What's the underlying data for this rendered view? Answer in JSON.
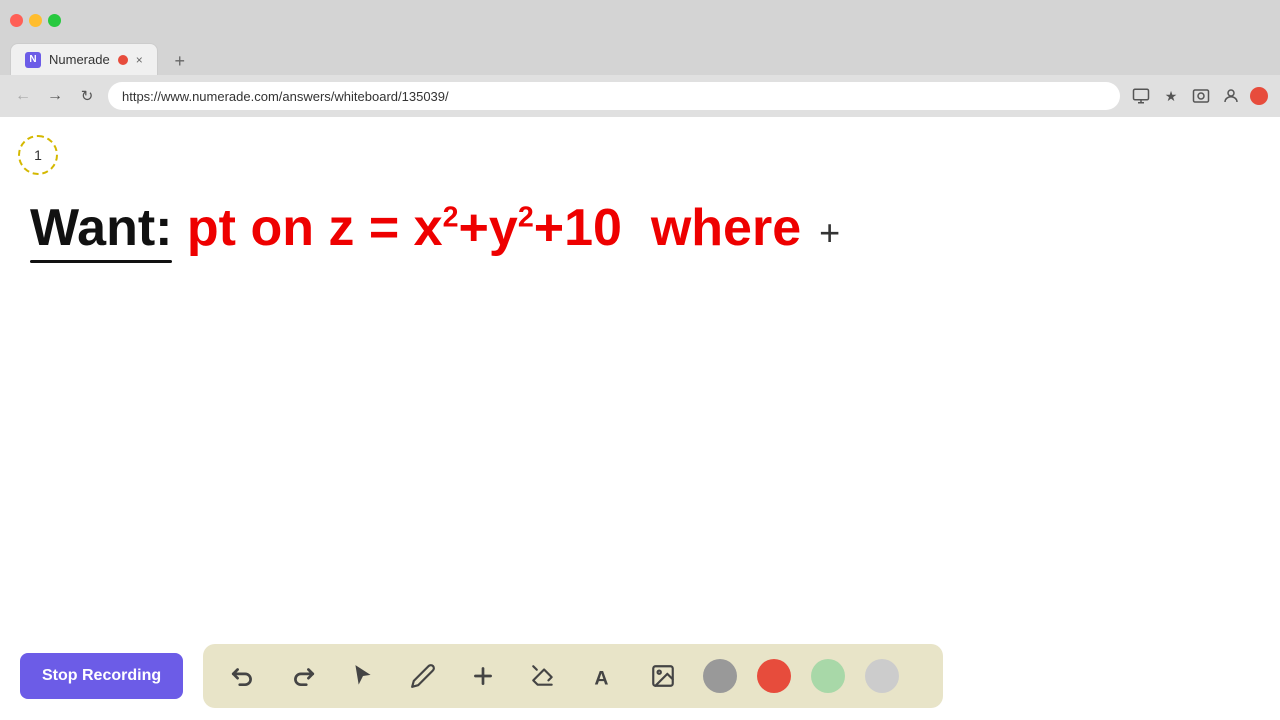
{
  "browser": {
    "tab_title": "Numerade",
    "url": "https://www.numerade.com/answers/whiteboard/135039/",
    "new_tab_label": "+",
    "tab_close_label": "×"
  },
  "toolbar": {
    "stop_recording_label": "Stop Recording",
    "tools": [
      {
        "name": "undo",
        "label": "↩",
        "icon": "undo-icon"
      },
      {
        "name": "redo",
        "label": "↪",
        "icon": "redo-icon"
      },
      {
        "name": "select",
        "label": "cursor",
        "icon": "select-icon"
      },
      {
        "name": "pen",
        "label": "✏",
        "icon": "pen-icon"
      },
      {
        "name": "add",
        "label": "+",
        "icon": "add-icon"
      },
      {
        "name": "eraser",
        "label": "◻",
        "icon": "eraser-icon"
      },
      {
        "name": "text",
        "label": "A",
        "icon": "text-icon"
      },
      {
        "name": "image",
        "label": "🖼",
        "icon": "image-icon"
      }
    ],
    "colors": [
      {
        "name": "gray",
        "value": "#999999"
      },
      {
        "name": "red",
        "value": "#e74c3c"
      },
      {
        "name": "light-green",
        "value": "#a8d8a8"
      },
      {
        "name": "light-gray",
        "value": "#cccccc"
      }
    ]
  },
  "whiteboard": {
    "page_number": "1",
    "equation_text": "Want: pt on z = x²+y²+10  where +"
  }
}
